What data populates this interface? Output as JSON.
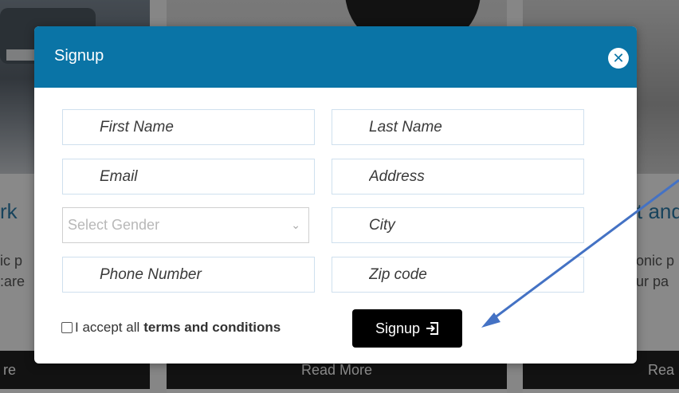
{
  "background": {
    "cards": [
      {
        "title": "rk",
        "lines": [
          "ic p",
          ":are"
        ],
        "button": "re"
      },
      {
        "title": "",
        "lines": [],
        "button": "Read More"
      },
      {
        "title": "t and",
        "lines": [
          "onic p",
          "ur pa"
        ],
        "button": "Rea"
      }
    ]
  },
  "modal": {
    "title": "Signup",
    "close_icon": "close-icon",
    "fields": {
      "first_name": "First Name",
      "last_name": "Last Name",
      "email": "Email",
      "address": "Address",
      "gender": "Select Gender",
      "city": "City",
      "phone": "Phone Number",
      "zip": "Zip code"
    },
    "terms_prefix": "I accept all",
    "terms_link": "terms and conditions",
    "signup_label": "Signup",
    "signup_icon": "sign-in-icon"
  },
  "colors": {
    "header": "#0a74a6",
    "annotation_arrow": "#4472c4"
  }
}
